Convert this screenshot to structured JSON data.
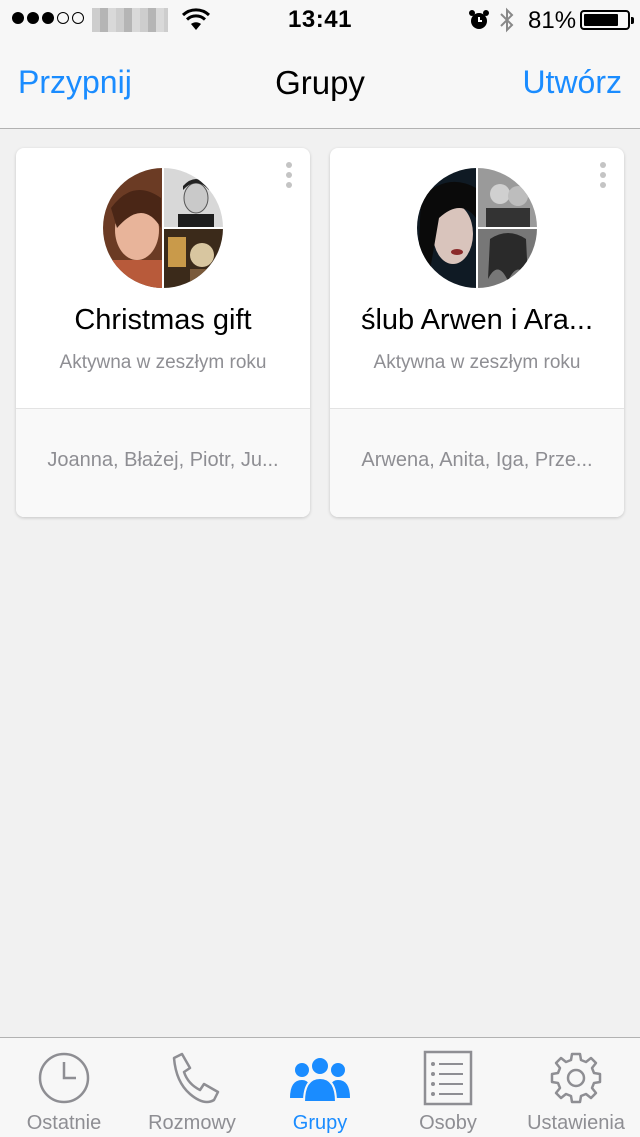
{
  "status_bar": {
    "time": "13:41",
    "battery_percent": "81%",
    "battery_level": 0.81,
    "signal_bars": 3,
    "signal_total": 5
  },
  "nav": {
    "left_button": "Przypnij",
    "title": "Grupy",
    "right_button": "Utwórz"
  },
  "groups": [
    {
      "name": "Christmas gift",
      "activity": "Aktywna w zeszłym roku",
      "members": "Joanna, Błażej, Piotr, Ju..."
    },
    {
      "name": "ślub Arwen i Ara...",
      "activity": "Aktywna w zeszłym roku",
      "members": "Arwena, Anita, Iga, Prze..."
    }
  ],
  "tabs": [
    {
      "label": "Ostatnie",
      "icon": "clock-icon"
    },
    {
      "label": "Rozmowy",
      "icon": "phone-icon"
    },
    {
      "label": "Grupy",
      "icon": "groups-icon",
      "active": true
    },
    {
      "label": "Osoby",
      "icon": "list-icon"
    },
    {
      "label": "Ustawienia",
      "icon": "gear-icon"
    }
  ],
  "colors": {
    "accent": "#1a8cff",
    "inactive": "#8e8e93",
    "background": "#f1f1f1"
  }
}
